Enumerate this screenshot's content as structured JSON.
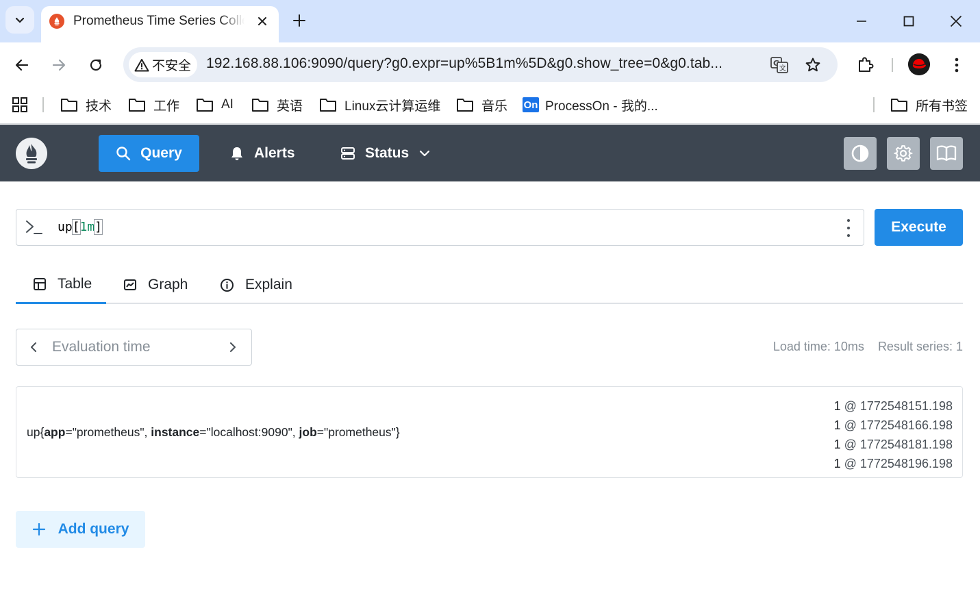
{
  "browser": {
    "tab_title": "Prometheus Time Series Collection and Processing Server",
    "security_label": "不安全",
    "url_host": "192.168.88.106",
    "url_rest": ":9090/query?g0.expr=up%5B1m%5D&g0.show_tree=0&g0.tab...",
    "bookmarks": [
      {
        "label": "技术"
      },
      {
        "label": "工作"
      },
      {
        "label": "AI"
      },
      {
        "label": "英语"
      },
      {
        "label": "Linux云计算运维"
      },
      {
        "label": "音乐"
      },
      {
        "label": "ProcessOn - 我的..."
      }
    ],
    "processon_badge": "On",
    "all_bookmarks": "所有书签"
  },
  "app": {
    "nav": {
      "query": "Query",
      "alerts": "Alerts",
      "status": "Status"
    },
    "query": {
      "fn": "up",
      "open": "[",
      "duration": "1m",
      "close": "]",
      "execute": "Execute"
    },
    "tabs": {
      "table": "Table",
      "graph": "Graph",
      "explain": "Explain"
    },
    "eval_time_placeholder": "Evaluation time",
    "load_time": "Load time: 10ms",
    "result_series": "Result series: 1",
    "result": {
      "metric": "up",
      "labels": [
        {
          "name": "app",
          "value": "\"prometheus\""
        },
        {
          "name": "instance",
          "value": "\"localhost:9090\""
        },
        {
          "name": "job",
          "value": "\"prometheus\""
        }
      ],
      "samples": [
        {
          "value": "1",
          "ts": "1772548151.198"
        },
        {
          "value": "1",
          "ts": "1772548166.198"
        },
        {
          "value": "1",
          "ts": "1772548181.198"
        },
        {
          "value": "1",
          "ts": "1772548196.198"
        }
      ]
    },
    "add_query": "Add query"
  }
}
